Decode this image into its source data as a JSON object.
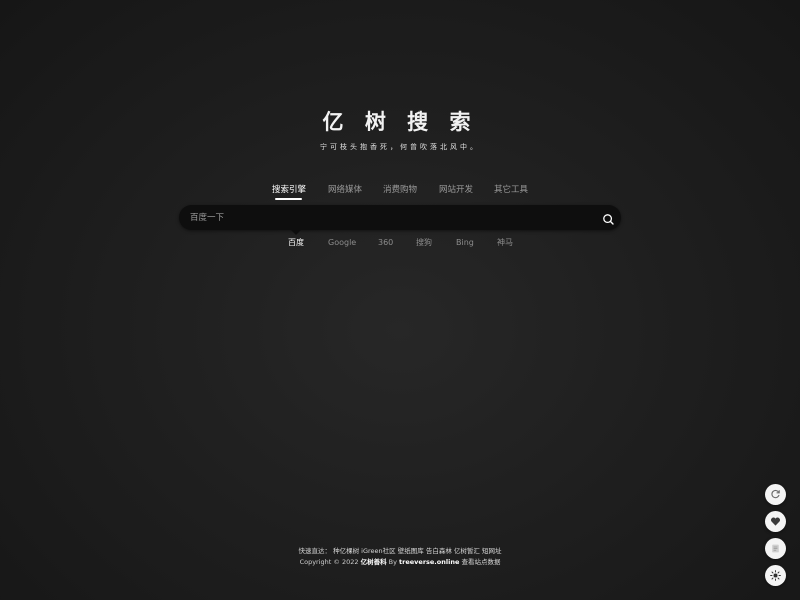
{
  "brand": {
    "title": "亿 树 搜 索",
    "tagline": "宁可枝头抱香死，何曾吹落北风中。"
  },
  "tabs": [
    {
      "label": "搜索引擎",
      "active": true
    },
    {
      "label": "网络媒体",
      "active": false
    },
    {
      "label": "消费购物",
      "active": false
    },
    {
      "label": "网站开发",
      "active": false
    },
    {
      "label": "其它工具",
      "active": false
    }
  ],
  "search": {
    "placeholder": "百度一下",
    "value": "",
    "icon": "search-icon"
  },
  "engines": [
    {
      "label": "百度",
      "active": true
    },
    {
      "label": "Google",
      "active": false
    },
    {
      "label": "360",
      "active": false
    },
    {
      "label": "搜狗",
      "active": false
    },
    {
      "label": "Bing",
      "active": false
    },
    {
      "label": "神马",
      "active": false
    }
  ],
  "footer": {
    "quick_label": "快速直达：",
    "links": [
      "种亿棵树",
      "iGreen社区",
      "壁纸图库",
      "告白森林",
      "亿树暂汇",
      "短网址"
    ],
    "copyright_prefix": "Copyright © 2022",
    "site_name": "亿树善科",
    "by": "By",
    "domain": "treeverse.online",
    "stats_link": "查看站点数据"
  },
  "side_buttons": [
    {
      "name": "refresh-icon"
    },
    {
      "name": "heart-icon"
    },
    {
      "name": "notes-icon"
    },
    {
      "name": "sun-icon"
    }
  ],
  "colors": {
    "background": "#1f1f1f",
    "search_bg": "#0e0e0e",
    "accent": "#ffffff",
    "muted_text": "#9a9a9a"
  }
}
